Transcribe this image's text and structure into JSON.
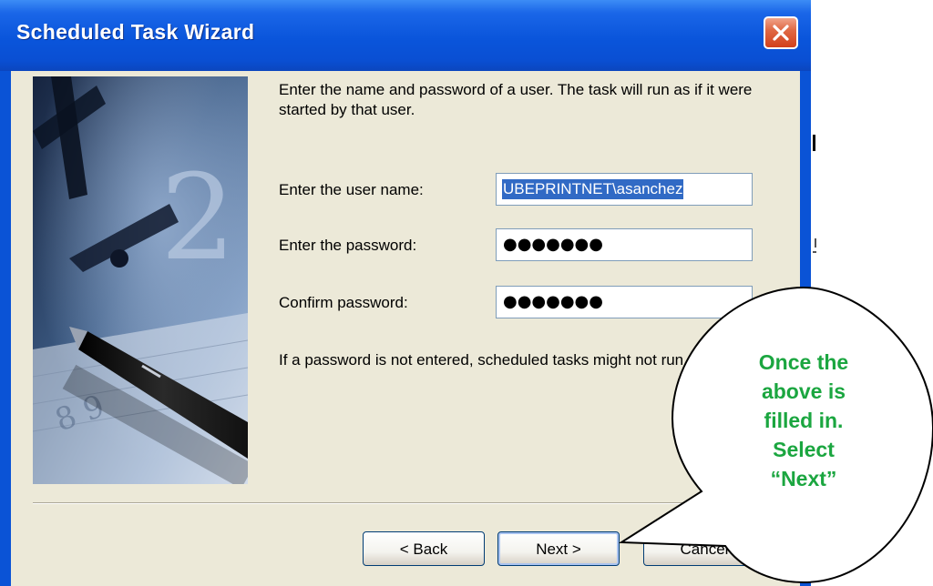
{
  "window": {
    "title": "Scheduled Task Wizard"
  },
  "wizard": {
    "intro": "Enter the name and password of a user.  The task will run as if it were started by that user.",
    "user_name_label": "Enter the user name:",
    "user_name_value": "UBEPRINTNET\\asanchez",
    "password_label": "Enter the password:",
    "password_mask": "●●●●●●●",
    "confirm_label": "Confirm password:",
    "confirm_mask": "●●●●●●●",
    "note": "If a password is not entered, scheduled tasks might not run."
  },
  "buttons": {
    "back": "< Back",
    "next": "Next >",
    "cancel": "Cancel"
  },
  "callout": {
    "lines": [
      "Once the",
      "above is",
      "filled in.",
      "Select",
      "“Next”"
    ],
    "color": "#1BA640"
  },
  "colors": {
    "titlebar": "#0A55DB",
    "client": "#ECE9D8",
    "selection": "#316AC5",
    "close": "#D2401C"
  }
}
